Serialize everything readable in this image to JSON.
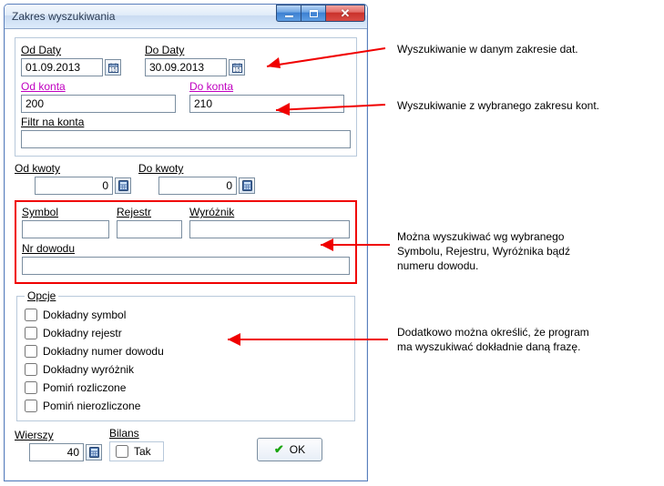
{
  "window": {
    "title": "Zakres wyszukiwania"
  },
  "dates": {
    "from_label": "Od Daty",
    "to_label": "Do Daty",
    "from_value": "01.09.2013",
    "to_value": "30.09.2013"
  },
  "accounts": {
    "from_label": "Od konta",
    "to_label": "Do konta",
    "from_value": "200",
    "to_value": "210",
    "filter_label": "Filtr na konta",
    "filter_value": ""
  },
  "amounts": {
    "from_label": "Od kwoty",
    "to_label": "Do kwoty",
    "from_value": "0",
    "to_value": "0"
  },
  "criteria": {
    "symbol_label": "Symbol",
    "rejestr_label": "Rejestr",
    "wyroznik_label": "Wyróżnik",
    "nr_dowodu_label": "Nr dowodu",
    "symbol_value": "",
    "rejestr_value": "",
    "wyroznik_value": "",
    "nr_dowodu_value": ""
  },
  "options": {
    "legend": "Opcje",
    "items": [
      "Dokładny symbol",
      "Dokładny rejestr",
      "Dokładny numer dowodu",
      "Dokładny wyróżnik",
      "Pomiń rozliczone",
      "Pomiń nierozliczone"
    ]
  },
  "footer": {
    "wierszy_label": "Wierszy",
    "wierszy_value": "40",
    "bilans_label": "Bilans",
    "bilans_tak": "Tak",
    "ok": "OK"
  },
  "annotations": {
    "a1": "Wyszukiwanie  w danym zakresie dat.",
    "a2": "Wyszukiwanie  z wybranego zakresu kont.",
    "a3_l1": "Można wyszukiwać wg wybranego",
    "a3_l2": "Symbolu, Rejestru, Wyróżnika bądź",
    "a3_l3": "numeru dowodu.",
    "a4_l1": "Dodatkowo można określić, że program",
    "a4_l2": "ma wyszukiwać dokładnie daną frazę."
  },
  "icons": {
    "calendar": "calendar-icon",
    "calculator": "calculator-icon"
  }
}
